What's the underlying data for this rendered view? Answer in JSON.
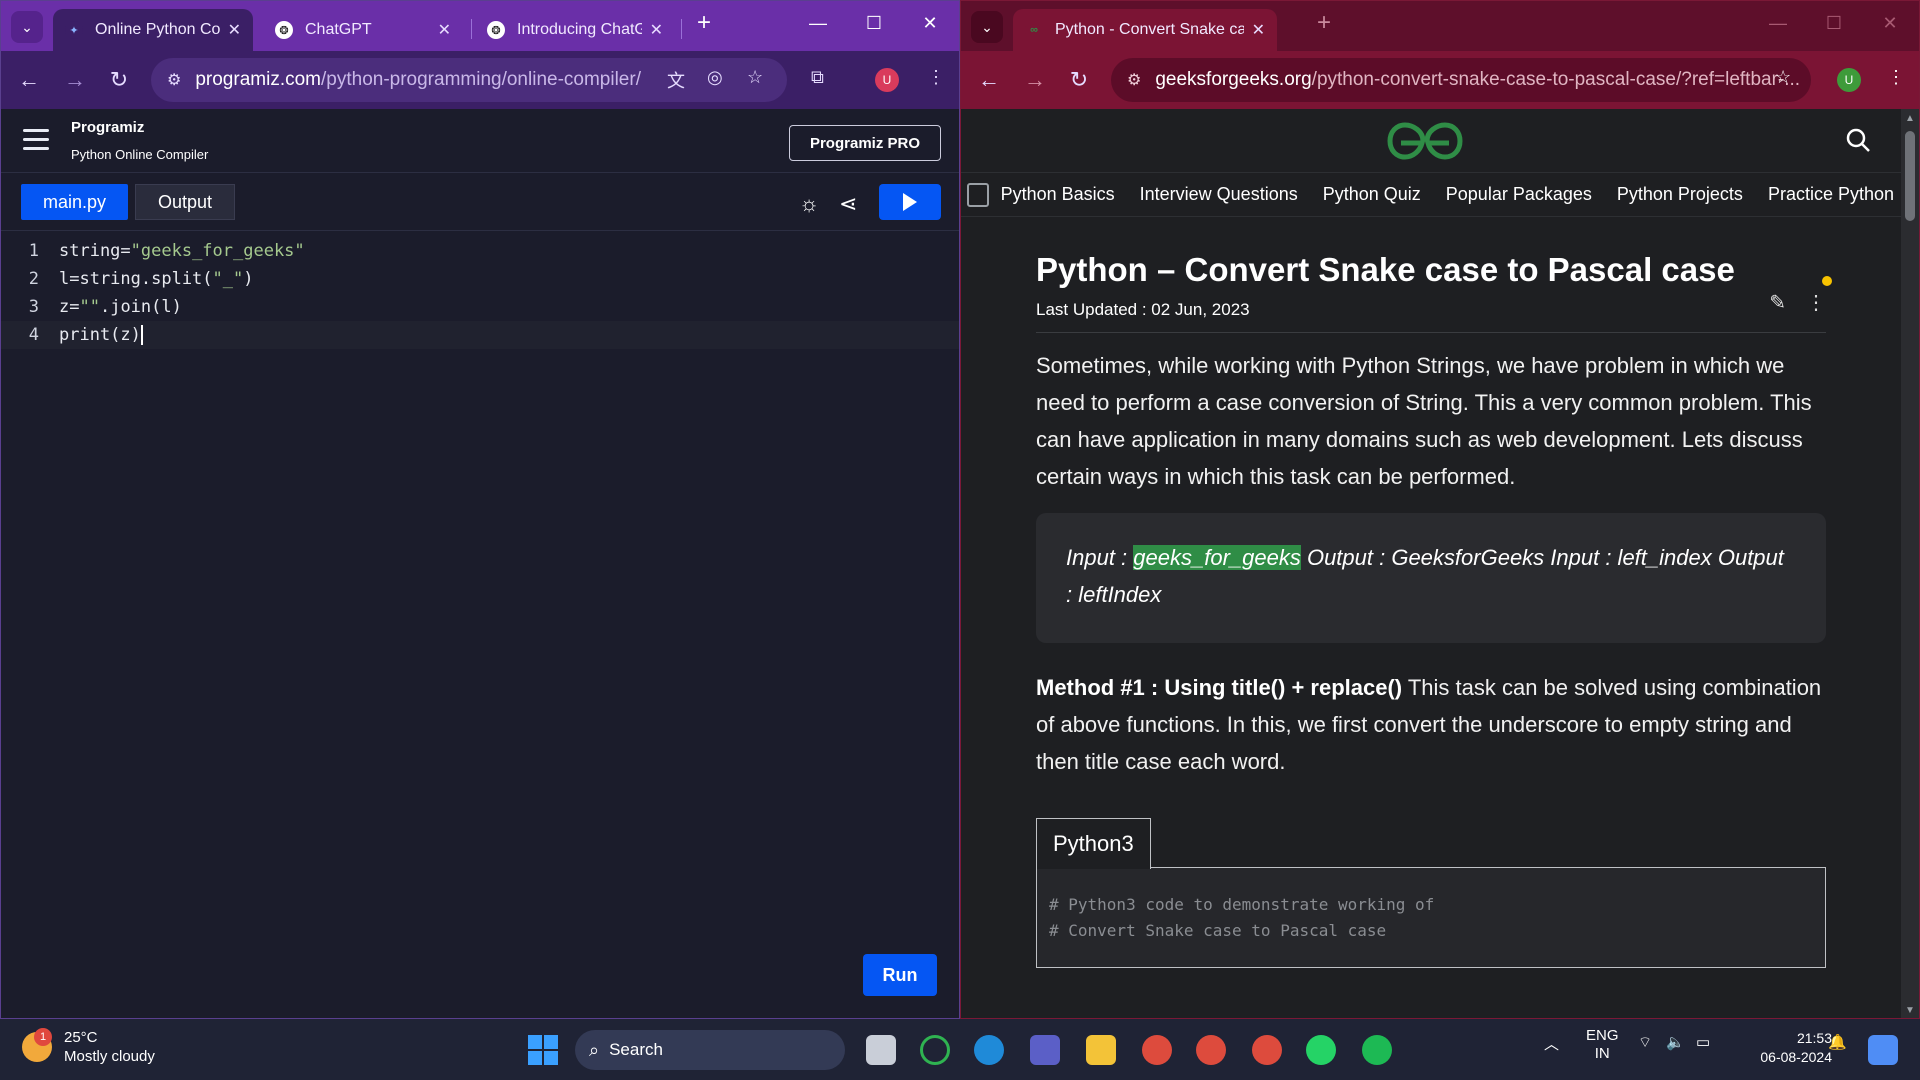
{
  "left_window": {
    "tabs": [
      {
        "title": "Online Python Com",
        "active": true
      },
      {
        "title": "ChatGPT",
        "active": false
      },
      {
        "title": "Introducing ChatG",
        "active": false
      }
    ],
    "url_host": "programiz.com",
    "url_path": "/python-programming/online-compiler/",
    "profile_initial": "U",
    "programiz": {
      "logo_text": "Programiz",
      "subtitle": "Python Online Compiler",
      "pro_button": "Programiz PRO",
      "file_tab": "main.py",
      "output_tab": "Output",
      "run_button": "Run"
    },
    "code_lines": [
      {
        "num": "1",
        "parts": [
          "string=",
          "\"geeks_for_geeks\""
        ]
      },
      {
        "num": "2",
        "parts": [
          "l=string.split(",
          "\"_\"",
          ")"
        ]
      },
      {
        "num": "3",
        "parts": [
          "z=",
          "\"\"",
          ".join(l)"
        ]
      },
      {
        "num": "4",
        "parts": [
          "print(z)"
        ]
      }
    ]
  },
  "right_window": {
    "tab_title": "Python - Convert Snake case to",
    "url_host": "geeksforgeeks.org",
    "url_path": "/python-convert-snake-case-to-pascal-case/?ref=leftbar-...",
    "profile_initial": "U",
    "nav_items": [
      "Python Basics",
      "Interview Questions",
      "Python Quiz",
      "Popular Packages",
      "Python Projects",
      "Practice Python"
    ],
    "article": {
      "title": "Python – Convert Snake case to Pascal case",
      "updated": "Last Updated : 02 Jun, 2023",
      "intro": "Sometimes, while working with Python Strings, we have problem in which we need to perform a case conversion of String. This a very common problem. This can have application in many domains such as web development. Lets discuss certain ways in which this task can be performed.",
      "example_prefix": "Input : ",
      "example_highlight": "geeks_for_geeks",
      "example_rest": " Output : GeeksforGeeks Input : left_index Output : leftIndex",
      "method_bold": "Method #1 : Using title() + replace()",
      "method_text": " This task can be solved using combination of above functions. In this, we first convert the underscore to empty string and then title case each word.",
      "code_tab": "Python3",
      "code_comment_1": "# Python3 code to demonstrate working of",
      "code_comment_2": "# Convert Snake case to Pascal case"
    }
  },
  "taskbar": {
    "weather_badge": "1",
    "temperature": "25°C",
    "condition": "Mostly cloudy",
    "search_label": "Search",
    "lang_1": "ENG",
    "lang_2": "IN",
    "time": "21:53",
    "date": "06-08-2024"
  },
  "colors": {
    "programiz_blue": "#0556f3",
    "gfg_green": "#2f8d46",
    "left_frame": "#6a2fa8",
    "right_frame": "#7b1434"
  }
}
